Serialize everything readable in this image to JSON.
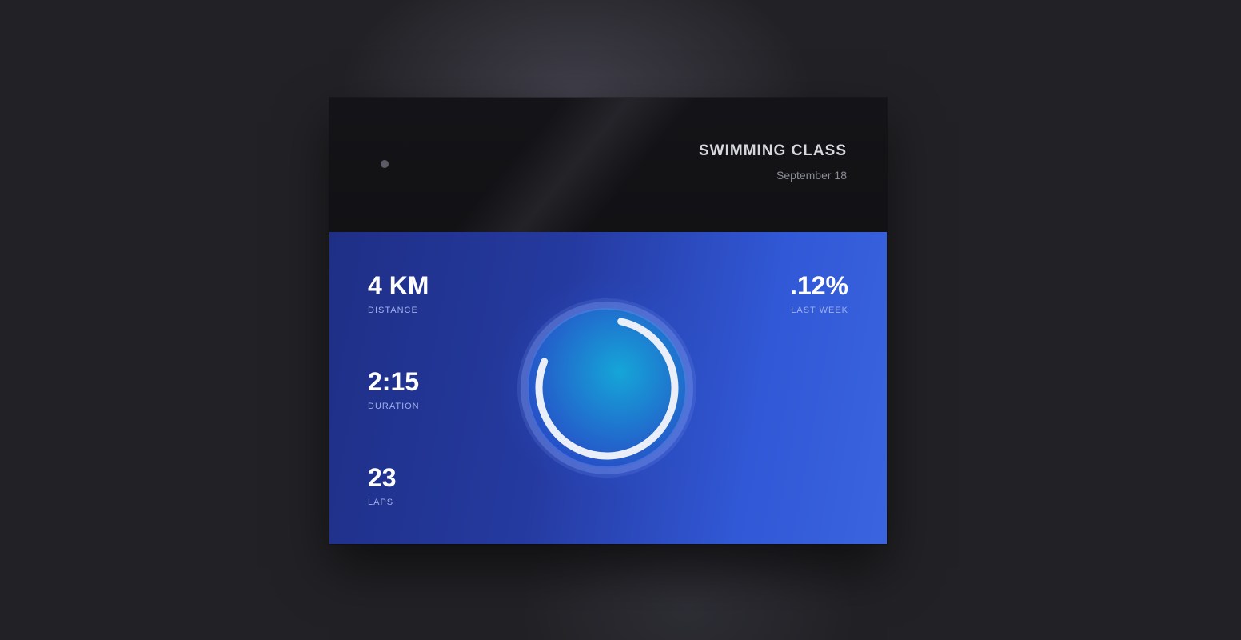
{
  "card": {
    "title": "SWIMMING CLASS",
    "date": "September 18"
  },
  "stats": [
    {
      "value": "4 KM",
      "label": "DISTANCE"
    },
    {
      "value": "2:15",
      "label": "DURATION"
    },
    {
      "value": "23",
      "label": "LAPS"
    }
  ],
  "comparison": {
    "value": ".12%",
    "label": "LAST WEEK"
  },
  "progress_ring": {
    "fraction": 0.78,
    "track_color": "#7f9bf0",
    "arc_color": "#e9eef9",
    "core_color_inner": "#15a6d8",
    "core_color_outer": "#2652c8"
  },
  "colors": {
    "background": "#222226",
    "header": "#131316",
    "body_left": "#1e2f86",
    "body_right": "#3a64e0"
  }
}
